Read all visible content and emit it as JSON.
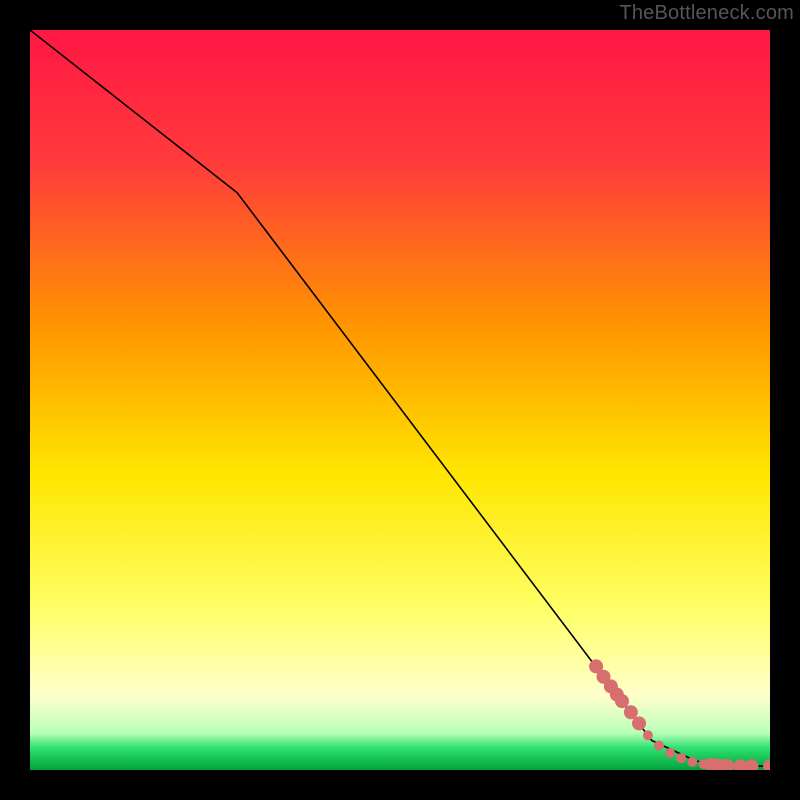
{
  "watermark": "TheBottleneck.com",
  "chart_data": {
    "type": "line",
    "title": "",
    "xlabel": "",
    "ylabel": "",
    "xlim": [
      0,
      100
    ],
    "ylim": [
      0,
      100
    ],
    "background_gradient": {
      "stops": [
        {
          "offset": 0,
          "color": "#ff1744"
        },
        {
          "offset": 18,
          "color": "#ff3b3b"
        },
        {
          "offset": 40,
          "color": "#ff9500"
        },
        {
          "offset": 60,
          "color": "#ffe600"
        },
        {
          "offset": 78,
          "color": "#ffff66"
        },
        {
          "offset": 90,
          "color": "#ffffcc"
        },
        {
          "offset": 95,
          "color": "#b8ffb8"
        },
        {
          "offset": 97,
          "color": "#2fe070"
        },
        {
          "offset": 100,
          "color": "#00a33a"
        }
      ]
    },
    "series": [
      {
        "name": "curve",
        "type": "line",
        "color": "#000000",
        "width": 1.6,
        "points": [
          {
            "x": 0,
            "y": 100
          },
          {
            "x": 28,
            "y": 78
          },
          {
            "x": 84,
            "y": 4
          },
          {
            "x": 90,
            "y": 1.2
          },
          {
            "x": 95,
            "y": 0.6
          },
          {
            "x": 100,
            "y": 0.5
          }
        ]
      },
      {
        "name": "markers",
        "type": "scatter",
        "color": "#d86f6f",
        "radius_small": 5,
        "radius_large": 7,
        "points": [
          {
            "x": 76.5,
            "y": 14.0,
            "r": "l"
          },
          {
            "x": 77.5,
            "y": 12.6,
            "r": "l"
          },
          {
            "x": 78.5,
            "y": 11.3,
            "r": "l"
          },
          {
            "x": 79.3,
            "y": 10.2,
            "r": "l"
          },
          {
            "x": 80.0,
            "y": 9.3,
            "r": "l"
          },
          {
            "x": 81.2,
            "y": 7.8,
            "r": "l"
          },
          {
            "x": 82.3,
            "y": 6.3,
            "r": "l"
          },
          {
            "x": 83.5,
            "y": 4.7,
            "r": "s"
          },
          {
            "x": 85.0,
            "y": 3.3,
            "r": "s"
          },
          {
            "x": 86.5,
            "y": 2.3,
            "r": "s"
          },
          {
            "x": 88.0,
            "y": 1.6,
            "r": "s"
          },
          {
            "x": 89.5,
            "y": 1.1,
            "r": "s"
          },
          {
            "x": 91.0,
            "y": 0.8,
            "r": "s"
          },
          {
            "x": 92.0,
            "y": 0.7,
            "r": "l"
          },
          {
            "x": 93.0,
            "y": 0.6,
            "r": "l"
          },
          {
            "x": 94.2,
            "y": 0.55,
            "r": "l"
          },
          {
            "x": 96.0,
            "y": 0.5,
            "r": "l"
          },
          {
            "x": 97.5,
            "y": 0.5,
            "r": "l"
          },
          {
            "x": 100.0,
            "y": 0.5,
            "r": "l"
          }
        ]
      }
    ]
  }
}
